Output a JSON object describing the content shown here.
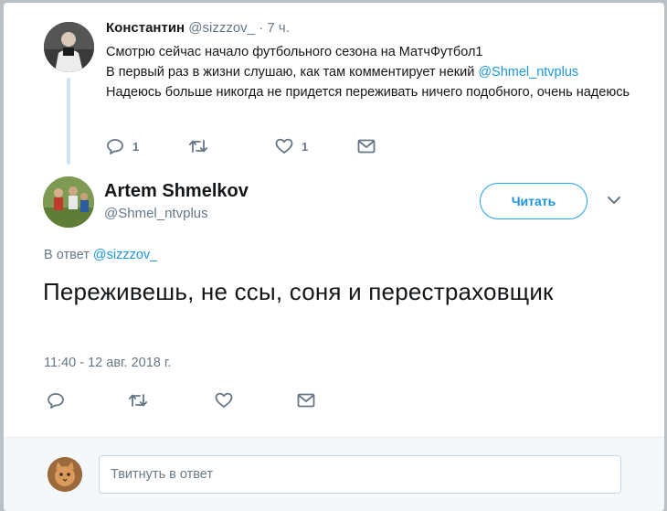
{
  "parent_tweet": {
    "author_name": "Константин",
    "author_handle": "@sizzzov_",
    "separator": "·",
    "time_ago": "7 ч.",
    "lines": {
      "line1": "Смотрю сейчас начало футбольного сезона на МатчФутбол1",
      "line2_prefix": "В первый раз в жизни слушаю, как там комментирует некий ",
      "line2_mention": "@Shmel_ntvplus",
      "line3": "Надеюсь больше никогда не придется переживать ничего подобного, очень надеюсь"
    },
    "reply_count": "1",
    "like_count": "1"
  },
  "main_tweet": {
    "author_name": "Artem Shmelkov",
    "author_handle": "@Shmel_ntvplus",
    "follow_label": "Читать",
    "reply_to_prefix": "В ответ",
    "reply_to_handle": "@sizzzov_",
    "text": "Переживешь, не ссы, соня и перестраховщик",
    "timestamp": "11:40 - 12 авг. 2018 г."
  },
  "reply_box": {
    "placeholder": "Твитнуть в ответ"
  },
  "colors": {
    "accent": "#1da1f2",
    "link": "#1b95e0",
    "muted": "#657786",
    "thread_line": "#cfe3f1"
  },
  "icons": [
    "reply-icon",
    "retweet-icon",
    "like-icon",
    "dm-icon",
    "chevron-down-icon"
  ]
}
